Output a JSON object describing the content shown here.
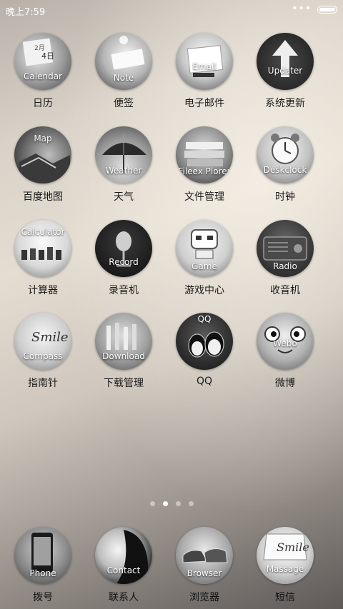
{
  "status_bar": {
    "time": "晚上7:59",
    "signal_dots": "•••"
  },
  "apps": [
    {
      "name": "日历",
      "icon_label": "Calendar",
      "icon": "calendar-icon"
    },
    {
      "name": "便签",
      "icon_label": "Note",
      "icon": "note-icon"
    },
    {
      "name": "电子邮件",
      "icon_label": "Email",
      "icon": "email-icon"
    },
    {
      "name": "系统更新",
      "icon_label": "Updater",
      "icon": "updater-icon"
    },
    {
      "name": "百度地图",
      "icon_label": "Map",
      "icon": "map-icon"
    },
    {
      "name": "天气",
      "icon_label": "Weather",
      "icon": "weather-icon"
    },
    {
      "name": "文件管理",
      "icon_label": "Fileex Plorer",
      "icon": "file-explorer-icon"
    },
    {
      "name": "时钟",
      "icon_label": "Deskclock",
      "icon": "clock-icon"
    },
    {
      "name": "计算器",
      "icon_label": "Calculator",
      "icon": "calculator-icon"
    },
    {
      "name": "录音机",
      "icon_label": "Record",
      "icon": "record-icon"
    },
    {
      "name": "游戏中心",
      "icon_label": "Game",
      "icon": "game-icon"
    },
    {
      "name": "收音机",
      "icon_label": "Radio",
      "icon": "radio-icon"
    },
    {
      "name": "指南针",
      "icon_label": "Compass",
      "icon": "compass-icon"
    },
    {
      "name": "下载管理",
      "icon_label": "Download",
      "icon": "download-icon"
    },
    {
      "name": "QQ",
      "icon_label": "QQ",
      "icon": "qq-icon"
    },
    {
      "name": "微博",
      "icon_label": "Webo",
      "icon": "weibo-icon"
    }
  ],
  "pager": {
    "count": 4,
    "active": 1
  },
  "dock": [
    {
      "name": "拨号",
      "icon_label": "Phone",
      "icon": "phone-icon"
    },
    {
      "name": "联系人",
      "icon_label": "Contact",
      "icon": "contacts-icon"
    },
    {
      "name": "浏览器",
      "icon_label": "Browser",
      "icon": "browser-icon"
    },
    {
      "name": "短信",
      "icon_label": "Massage",
      "icon": "messages-icon"
    }
  ],
  "colors": {
    "label_text": "#1a1a1a",
    "icon_overlay_text": "#ffffff"
  }
}
